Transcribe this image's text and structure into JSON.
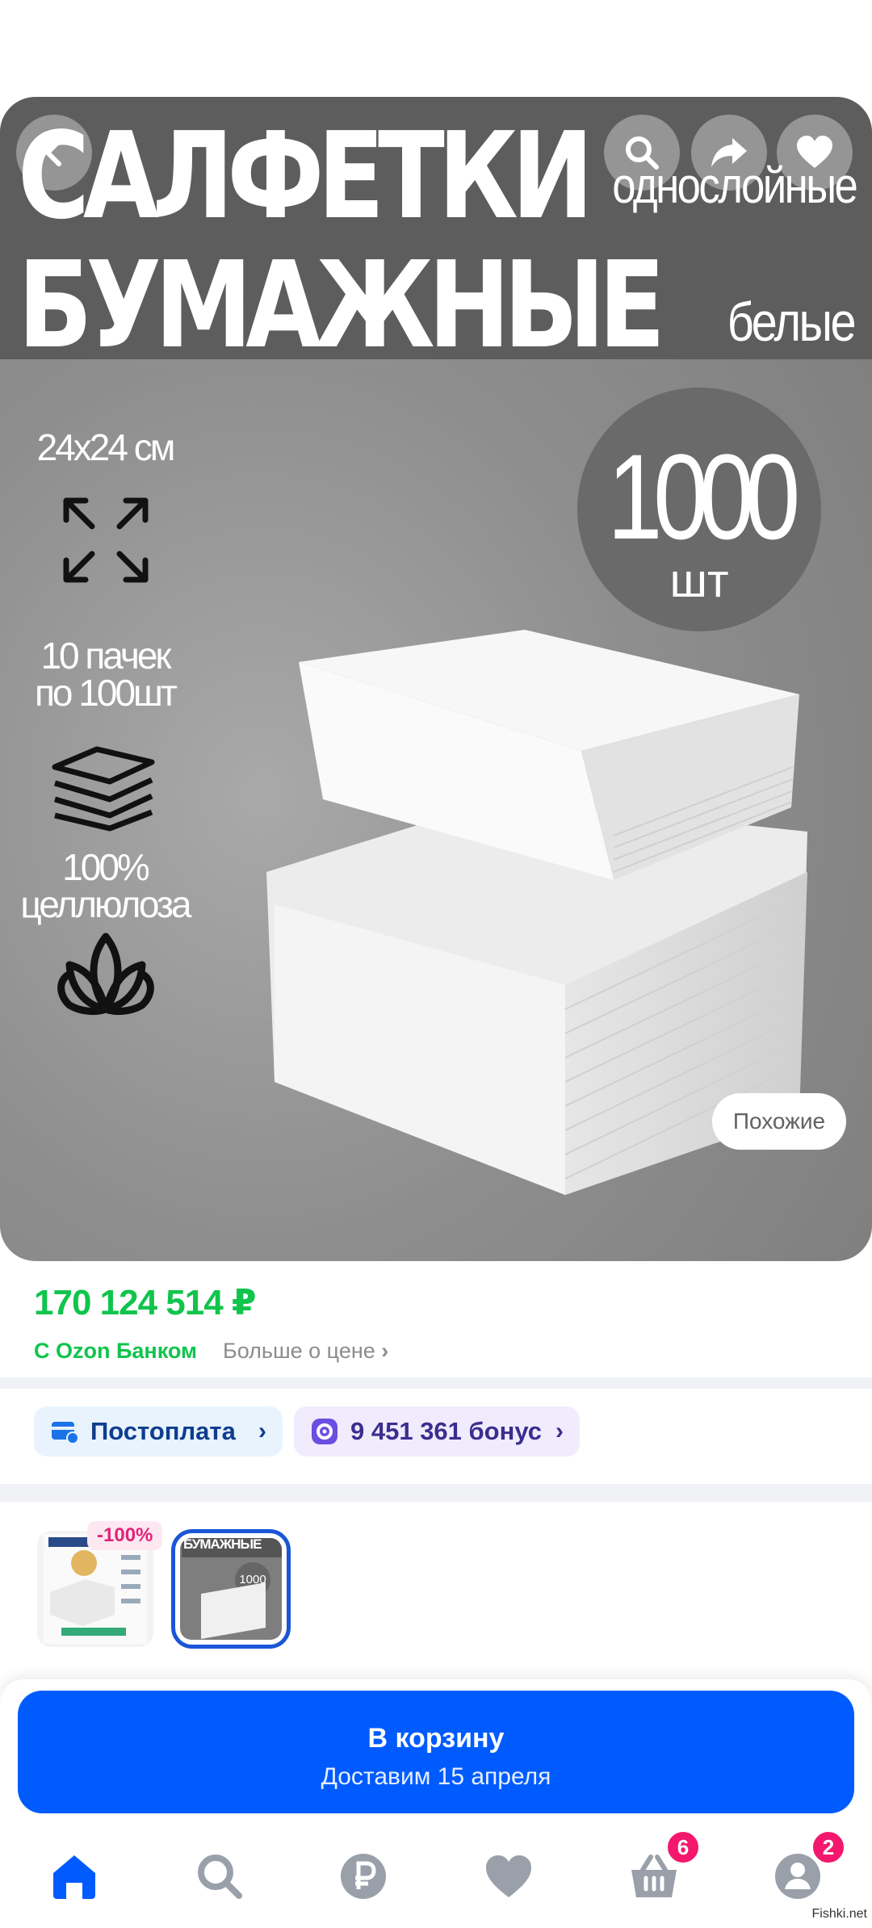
{
  "hero": {
    "title_line1": "САЛФЕТКИ",
    "title_line2": "БУМАЖНЫЕ",
    "subtitle1": "однослойные",
    "subtitle2": "белые",
    "count": "1000",
    "count_unit": "шт",
    "feature_size": "24x24 см",
    "feature_packs": "10 пачек по 100шт",
    "feature_packs_line1": "10 пачек",
    "feature_packs_line2": "по 100шт",
    "feature_material_line1": "100%",
    "feature_material_line2": "целлюлоза",
    "similar_button": "Похожие"
  },
  "price": {
    "value": "170 124 514 ₽",
    "bank_label": "С Ozon Банком",
    "more_label": "Больше о цене"
  },
  "chips": {
    "postpay": "Постоплата",
    "bonus": "9 451 361 бонус"
  },
  "variants": {
    "discount": "-100%",
    "thumb2_text": "БУМАЖНЫЕ",
    "thumb2_count": "1000"
  },
  "cart": {
    "title": "В корзину",
    "subtitle": "Доставим 15 апреля"
  },
  "tabs": {
    "cart_badge": "6",
    "profile_badge": "2"
  },
  "colors": {
    "accent_blue": "#005bff",
    "price_green": "#10c44c",
    "badge_pink": "#f3186d"
  },
  "watermark": "Fishki.net"
}
